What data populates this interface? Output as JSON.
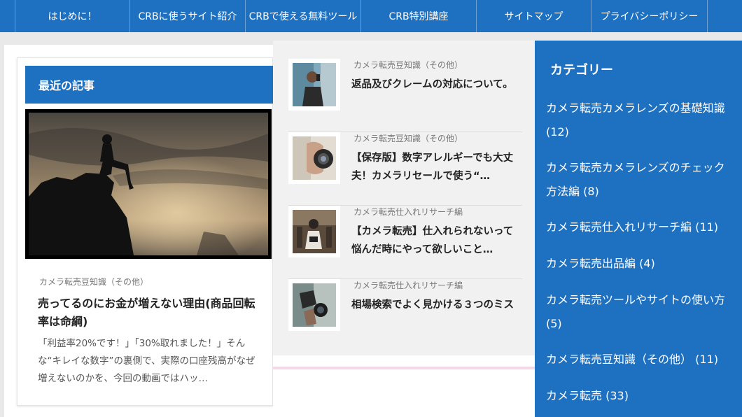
{
  "nav": {
    "items": [
      {
        "label": "はじめに！"
      },
      {
        "label": "CRBに使うサイト紹介"
      },
      {
        "label": "CRBで使える無料ツール"
      },
      {
        "label": "CRB特別講座"
      },
      {
        "label": "サイトマップ"
      },
      {
        "label": "プライバシーポリシー"
      }
    ]
  },
  "recent": {
    "header": "最近の記事",
    "featured": {
      "category": "カメラ転売豆知識（その他）",
      "title": "売ってるのにお金が増えない理由(商品回転率は命綱)",
      "excerpt": "「利益率20%です！」「30%取れました！」そんな“キレイな数字”の裏側で、実際の口座残高がなぜ増えないのかを、今回の動画ではハッ…"
    },
    "articles": [
      {
        "category": "カメラ転売豆知識（その他）",
        "title": "返品及びクレームの対応について。",
        "thumb_icon": "man-on-phone-thumbnail"
      },
      {
        "category": "カメラ転売豆知識（その他）",
        "title": "【保存版】数字アレルギーでも大丈夫！カメラリセールで使う“…",
        "thumb_icon": "camera-lens-thumbnail"
      },
      {
        "category": "カメラ転売仕入れリサーチ編",
        "title": "【カメラ転売】仕入れられないって悩んだ時にやって欲しいこと…",
        "thumb_icon": "woman-with-camera-thumbnail"
      },
      {
        "category": "カメラ転売仕入れリサーチ編",
        "title": "相場検索でよく見かける３つのミス",
        "thumb_icon": "hands-holding-camera-thumbnail"
      }
    ]
  },
  "sidebar": {
    "title": "カテゴリー",
    "categories": [
      {
        "label": "カメラ転売カメラレンズの基礎知識 (12)"
      },
      {
        "label": "カメラ転売カメラレンズのチェック方法編 (8)"
      },
      {
        "label": "カメラ転売仕入れリサーチ編 (11)"
      },
      {
        "label": "カメラ転売出品編 (4)"
      },
      {
        "label": "カメラ転売ツールやサイトの使い方 (5)"
      },
      {
        "label": "カメラ転売豆知識（その他） (11)"
      },
      {
        "label": "カメラ転売 (33)"
      }
    ]
  },
  "colors": {
    "brand_blue": "#1e70c1",
    "panel_gray": "#f1f1f1"
  }
}
